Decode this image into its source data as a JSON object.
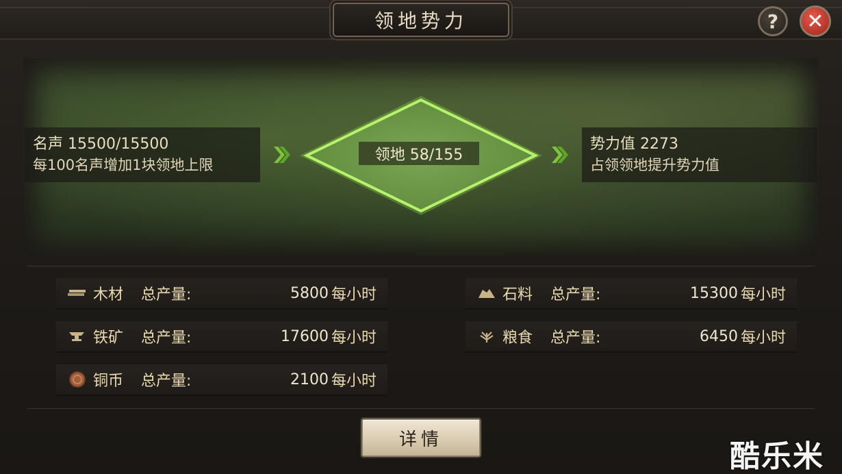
{
  "window": {
    "title": "领地势力"
  },
  "controls": {
    "help": "?",
    "close": "✕"
  },
  "territory": {
    "fame_line": "名声 15500/15500",
    "fame_desc": "每100名声增加1块领地上限",
    "territory_label": "领地 58/155",
    "power_line": "势力值 2273",
    "power_desc": "占领领地提升势力值"
  },
  "resources": {
    "total_label": "总产量:",
    "unit": "每小时",
    "left": [
      {
        "name": "木材",
        "value": "5800",
        "icon": "wood-icon"
      },
      {
        "name": "铁矿",
        "value": "17600",
        "icon": "anvil-icon"
      },
      {
        "name": "铜币",
        "value": "2100",
        "icon": "coin-icon"
      }
    ],
    "right": [
      {
        "name": "石料",
        "value": "15300",
        "icon": "stone-icon"
      },
      {
        "name": "粮食",
        "value": "6450",
        "icon": "grain-icon"
      }
    ]
  },
  "actions": {
    "detail": "详情"
  },
  "watermark": "酷乐米",
  "colors": {
    "territory_green": "#8fd64a",
    "arrow_green": "#7fc43a",
    "close_red": "#c8372a"
  }
}
